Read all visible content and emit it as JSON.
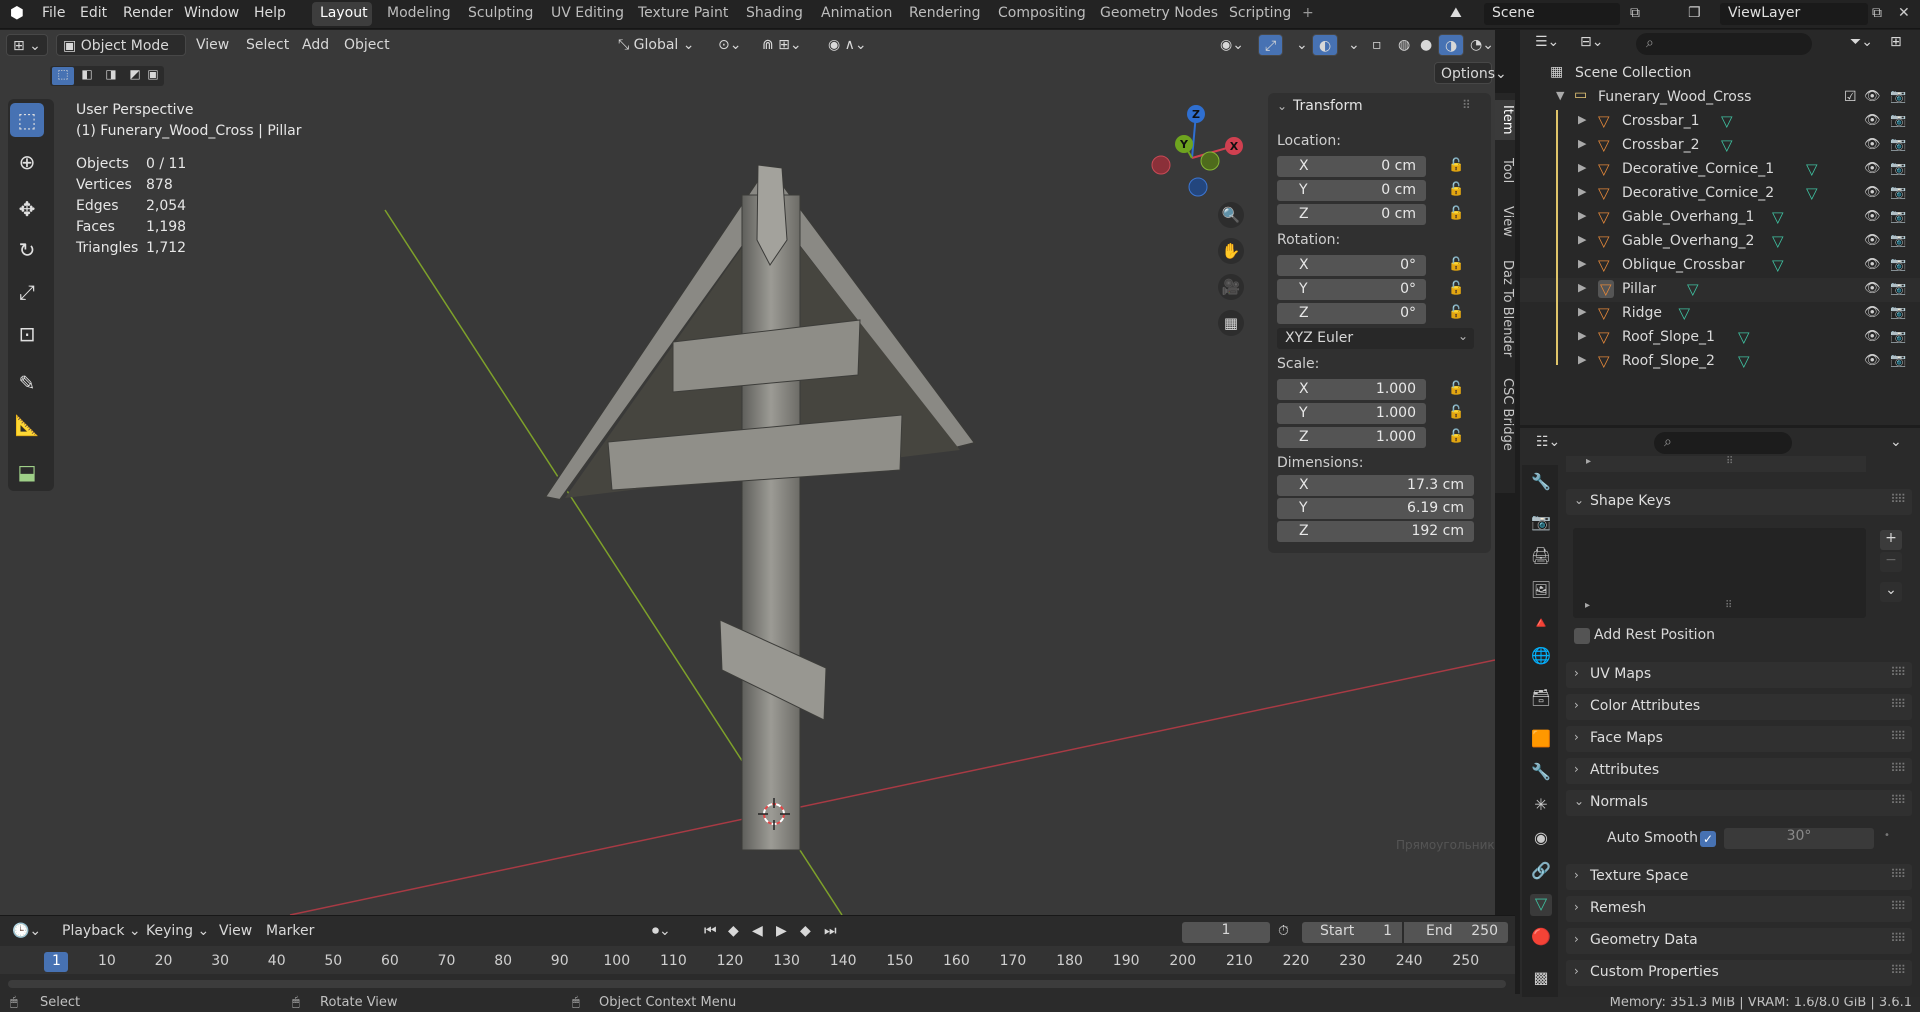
{
  "topbar": {
    "menus": [
      "File",
      "Edit",
      "Render",
      "Window",
      "Help"
    ],
    "workspaces": [
      "Layout",
      "Modeling",
      "Sculpting",
      "UV Editing",
      "Texture Paint",
      "Shading",
      "Animation",
      "Rendering",
      "Compositing",
      "Geometry Nodes",
      "Scripting"
    ],
    "add_tab": "+",
    "scene": "Scene",
    "view_layer": "ViewLayer"
  },
  "viewport_header": {
    "mode": "Object Mode",
    "menus": [
      "View",
      "Select",
      "Add",
      "Object"
    ],
    "orientation": "Global",
    "options": "Options"
  },
  "overlay": {
    "view_name": "User Perspective",
    "object_name": "(1) Funerary_Wood_Cross | Pillar",
    "stats": [
      {
        "label": "Objects",
        "value": "0 / 11"
      },
      {
        "label": "Vertices",
        "value": "878"
      },
      {
        "label": "Edges",
        "value": "2,054"
      },
      {
        "label": "Faces",
        "value": "1,198"
      },
      {
        "label": "Triangles",
        "value": "1,712"
      }
    ]
  },
  "gizmo": {
    "x": "X",
    "y": "Y",
    "z": "Z"
  },
  "transform": {
    "title": "Transform",
    "location_label": "Location:",
    "location": [
      {
        "axis": "X",
        "value": "0 cm"
      },
      {
        "axis": "Y",
        "value": "0 cm"
      },
      {
        "axis": "Z",
        "value": "0 cm"
      }
    ],
    "rotation_label": "Rotation:",
    "rotation": [
      {
        "axis": "X",
        "value": "0°"
      },
      {
        "axis": "Y",
        "value": "0°"
      },
      {
        "axis": "Z",
        "value": "0°"
      }
    ],
    "rotation_mode": "XYZ Euler",
    "scale_label": "Scale:",
    "scale": [
      {
        "axis": "X",
        "value": "1.000"
      },
      {
        "axis": "Y",
        "value": "1.000"
      },
      {
        "axis": "Z",
        "value": "1.000"
      }
    ],
    "dimensions_label": "Dimensions:",
    "dimensions": [
      {
        "axis": "X",
        "value": "17.3 cm"
      },
      {
        "axis": "Y",
        "value": "6.19 cm"
      },
      {
        "axis": "Z",
        "value": "192 cm"
      }
    ]
  },
  "side_tabs": [
    "Item",
    "Tool",
    "View",
    "Daz To Blender",
    "CSC Bridge"
  ],
  "timeline": {
    "menus": [
      "Playback",
      "Keying",
      "View",
      "Marker"
    ],
    "current_frame": "1",
    "start_label": "Start",
    "start": "1",
    "end_label": "End",
    "end": "250",
    "ticks": [
      "1",
      "10",
      "20",
      "30",
      "40",
      "50",
      "60",
      "70",
      "80",
      "90",
      "100",
      "110",
      "120",
      "130",
      "140",
      "150",
      "160",
      "170",
      "180",
      "190",
      "200",
      "210",
      "220",
      "230",
      "240",
      "250"
    ]
  },
  "statusbar": {
    "select": "Select",
    "rotate": "Rotate View",
    "context": "Object Context Menu",
    "memory": "Memory: 351.3 MiB | VRAM: 1.6/8.0 GiB | 3.6.1"
  },
  "outliner": {
    "root": "Scene Collection",
    "collection": "Funerary_Wood_Cross",
    "items": [
      "Crossbar_1",
      "Crossbar_2",
      "Decorative_Cornice_1",
      "Decorative_Cornice_2",
      "Gable_Overhang_1",
      "Gable_Overhang_2",
      "Oblique_Crossbar",
      "Pillar",
      "Ridge",
      "Roof_Slope_1",
      "Roof_Slope_2"
    ]
  },
  "properties": {
    "shape_keys": "Shape Keys",
    "add_rest_position": "Add Rest Position",
    "sections": [
      "UV Maps",
      "Color Attributes",
      "Face Maps",
      "Attributes"
    ],
    "normals": "Normals",
    "auto_smooth": "Auto Smooth",
    "auto_smooth_angle": "30°",
    "sections_after": [
      "Texture Space",
      "Remesh",
      "Geometry Data",
      "Custom Properties"
    ],
    "ghost_text": "Прямоугольник"
  },
  "colors": {
    "accent": "#4772b3",
    "object": "#e0863a",
    "mesh": "#3fc0a0"
  }
}
